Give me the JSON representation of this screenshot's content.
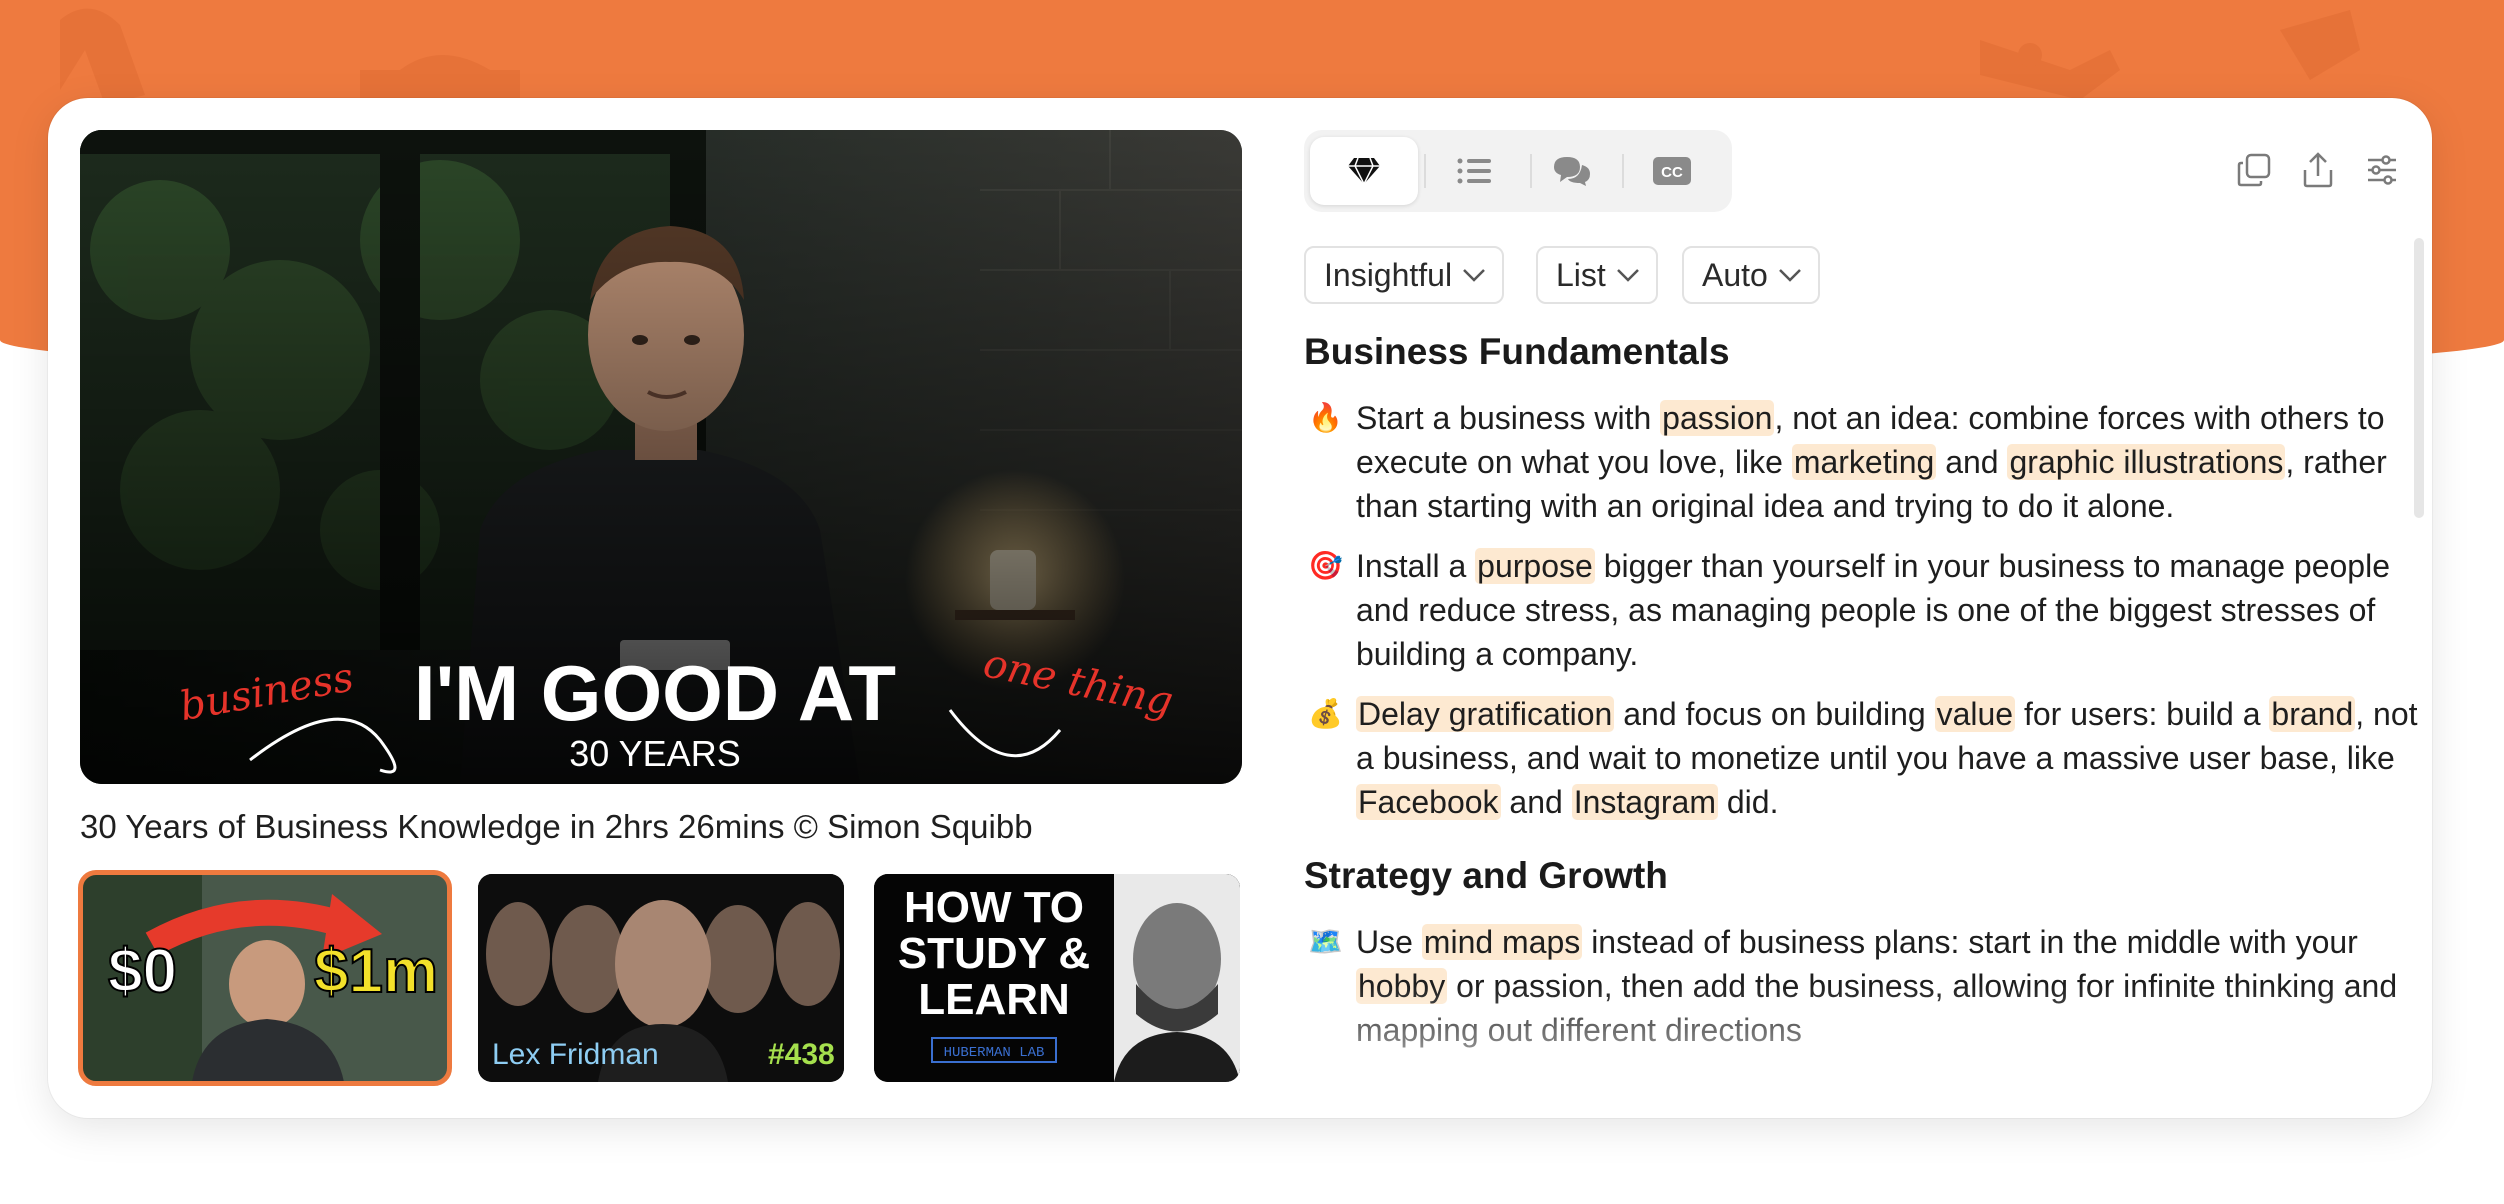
{
  "colors": {
    "accent": "#ee7a3f",
    "highlight": "#fde9d1"
  },
  "video": {
    "caption_small_left": "business",
    "caption_main": "I'M GOOD AT",
    "caption_sub": "30 YEARS",
    "caption_small_right": "one thing",
    "title": "30 Years of Business Knowledge in 2hrs 26mins © Simon Squibb"
  },
  "thumbnails": [
    {
      "text_left": "$0",
      "text_right": "$1m",
      "active": true
    },
    {
      "text_left": "Lex Fridman",
      "text_right": "#438",
      "active": false
    },
    {
      "line1": "HOW TO",
      "line2": "STUDY &",
      "line3": "LEARN",
      "badge": "HUBERMAN LAB",
      "active": false
    }
  ],
  "tabs": [
    {
      "icon": "gem-icon",
      "active": true
    },
    {
      "icon": "list-icon",
      "active": false
    },
    {
      "icon": "chat-icon",
      "active": false
    },
    {
      "icon": "cc-icon",
      "label": "CC",
      "active": false
    }
  ],
  "tools": [
    {
      "icon": "copy-icon"
    },
    {
      "icon": "share-icon"
    },
    {
      "icon": "settings-sliders-icon"
    }
  ],
  "dropdowns": {
    "style": "Insightful",
    "format": "List",
    "language": "Auto"
  },
  "sections": [
    {
      "heading": "Business Fundamentals",
      "bullets": [
        {
          "emoji": "🔥",
          "parts": [
            {
              "t": "Start a business with "
            },
            {
              "t": "passion",
              "h": true
            },
            {
              "t": ", not an idea: combine forces with others to execute on what you love, like "
            },
            {
              "t": "marketing",
              "h": true
            },
            {
              "t": " and "
            },
            {
              "t": "graphic illustrations",
              "h": true
            },
            {
              "t": ", rather than starting with an original idea and trying to do it alone."
            }
          ]
        },
        {
          "emoji": "🎯",
          "parts": [
            {
              "t": "Install a "
            },
            {
              "t": "purpose",
              "h": true
            },
            {
              "t": " bigger than yourself in your business to manage people and reduce stress, as managing people is one of the biggest stresses of building a company."
            }
          ]
        },
        {
          "emoji": "💰",
          "parts": [
            {
              "t": "Delay gratification",
              "h": true
            },
            {
              "t": " and focus on building "
            },
            {
              "t": "value",
              "h": true
            },
            {
              "t": " for users: build a "
            },
            {
              "t": "brand",
              "h": true
            },
            {
              "t": ", not a business, and wait to monetize until you have a massive user base, like "
            },
            {
              "t": "Facebook",
              "h": true
            },
            {
              "t": " and "
            },
            {
              "t": "Instagram",
              "h": true
            },
            {
              "t": " did."
            }
          ]
        }
      ]
    },
    {
      "heading": "Strategy and Growth",
      "bullets": [
        {
          "emoji": "🗺️",
          "parts": [
            {
              "t": "Use "
            },
            {
              "t": "mind maps",
              "h": true
            },
            {
              "t": " instead of business plans: start in the middle with your "
            },
            {
              "t": "hobby",
              "h": true
            },
            {
              "t": " or passion, then add the business, allowing for infinite thinking and mapping out different directions"
            }
          ]
        }
      ]
    }
  ]
}
